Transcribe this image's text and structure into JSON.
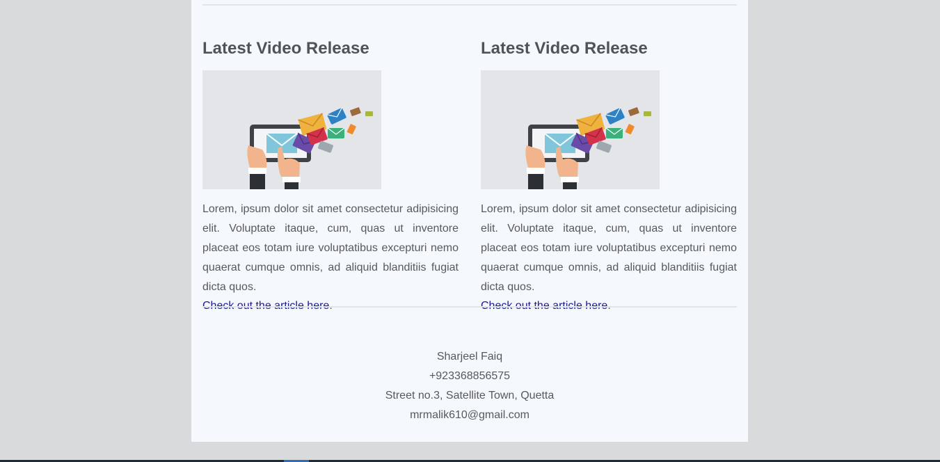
{
  "articles": [
    {
      "title": "Latest Video Release",
      "image_icon": "email-tablet-illustration",
      "body": "Lorem, ipsum dolor sit amet consectetur adipisicing elit. Voluptate itaque, cum, quas ut inventore placeat eos totam iure voluptatibus excepturi nemo quaerat cumque omnis, ad aliquid blanditiis fugiat dicta quos.",
      "link_text": "Check out the article here",
      "link_suffix": "."
    },
    {
      "title": "Latest Video Release",
      "image_icon": "email-tablet-illustration",
      "body": "Lorem, ipsum dolor sit amet consectetur adipisicing elit. Voluptate itaque, cum, quas ut inventore placeat eos totam iure voluptatibus excepturi nemo quaerat cumque omnis, ad aliquid blanditiis fugiat dicta quos.",
      "link_text": "Check out the article here",
      "link_suffix": "."
    }
  ],
  "footer": {
    "name": "Sharjeel Faiq",
    "phone": "+923368856575",
    "address": "Street no.3, Satellite Town, Quetta",
    "email": "mrmalik610@gmail.com"
  },
  "colors": {
    "background": "#d8dadb",
    "card": "#f5f8fc",
    "heading": "#505458",
    "body_text": "#56595d",
    "link": "#1b1b8f"
  }
}
